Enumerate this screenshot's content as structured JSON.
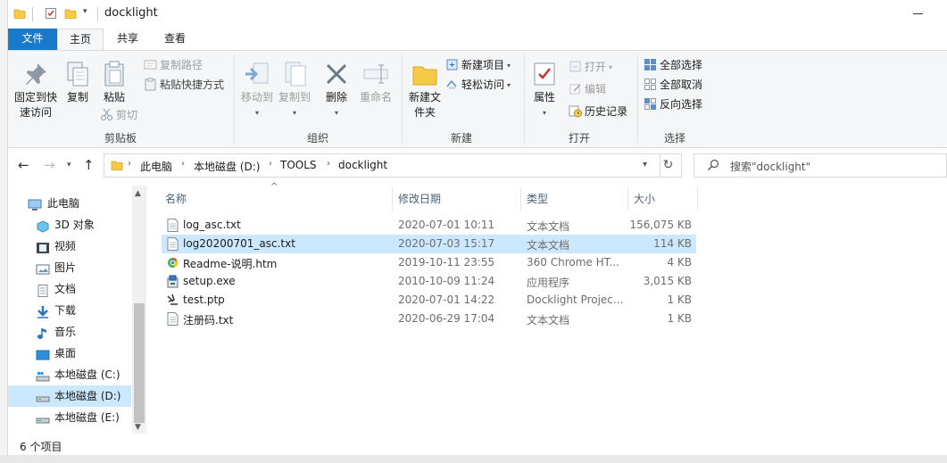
{
  "window": {
    "title": "docklight"
  },
  "tabs": {
    "file": "文件",
    "home": "主页",
    "share": "共享",
    "view": "查看"
  },
  "ribbon": {
    "clipboard": {
      "label": "剪贴板",
      "pin": "固定到快速访问",
      "copy": "复制",
      "paste": "粘贴",
      "copy_path": "复制路径",
      "paste_shortcut": "粘贴快捷方式",
      "cut": "剪切"
    },
    "organize": {
      "label": "组织",
      "move_to": "移动到",
      "copy_to": "复制到",
      "delete": "删除",
      "rename": "重命名"
    },
    "new": {
      "label": "新建",
      "new_folder": "新建文件夹",
      "new_item": "新建项目",
      "easy_access": "轻松访问"
    },
    "open": {
      "label": "打开",
      "properties": "属性",
      "open": "打开",
      "edit": "编辑",
      "history": "历史记录"
    },
    "select": {
      "label": "选择",
      "select_all": "全部选择",
      "select_none": "全部取消",
      "invert": "反向选择"
    }
  },
  "address": {
    "crumbs": [
      "此电脑",
      "本地磁盘 (D:)",
      "TOOLS",
      "docklight"
    ],
    "search_placeholder": "搜索\"docklight\""
  },
  "nav": {
    "items": [
      {
        "label": "此电脑",
        "icon": "computer-icon"
      },
      {
        "label": "3D 对象",
        "icon": "3d-objects-icon"
      },
      {
        "label": "视频",
        "icon": "video-icon"
      },
      {
        "label": "图片",
        "icon": "pictures-icon"
      },
      {
        "label": "文档",
        "icon": "documents-icon"
      },
      {
        "label": "下载",
        "icon": "download-icon"
      },
      {
        "label": "音乐",
        "icon": "music-icon"
      },
      {
        "label": "桌面",
        "icon": "desktop-icon"
      },
      {
        "label": "本地磁盘 (C:)",
        "icon": "drive-c-icon"
      },
      {
        "label": "本地磁盘 (D:)",
        "icon": "drive-d-icon",
        "selected": true
      },
      {
        "label": "本地磁盘 (E:)",
        "icon": "drive-e-icon"
      }
    ]
  },
  "columns": {
    "name": "名称",
    "date": "修改日期",
    "type": "类型",
    "size": "大小"
  },
  "files": [
    {
      "name": "log_asc.txt",
      "date": "2020-07-01 10:11",
      "type": "文本文档",
      "size": "156,075 KB",
      "icon": "text-file-icon"
    },
    {
      "name": "log20200701_asc.txt",
      "date": "2020-07-03 15:17",
      "type": "文本文档",
      "size": "114 KB",
      "icon": "text-file-icon",
      "selected": true
    },
    {
      "name": "Readme-说明.htm",
      "date": "2019-10-11 23:55",
      "type": "360 Chrome HT...",
      "size": "4 KB",
      "icon": "html-file-icon"
    },
    {
      "name": "setup.exe",
      "date": "2010-10-09 11:24",
      "type": "应用程序",
      "size": "3,015 KB",
      "icon": "installer-icon"
    },
    {
      "name": "test.ptp",
      "date": "2020-07-01 14:22",
      "type": "Docklight Projec...",
      "size": "1 KB",
      "icon": "project-file-icon"
    },
    {
      "name": "注册码.txt",
      "date": "2020-06-29 17:04",
      "type": "文本文档",
      "size": "1 KB",
      "icon": "text-file-icon"
    }
  ],
  "status": {
    "count": "6 个项目"
  },
  "colors": {
    "accent": "#1979ca",
    "selection": "#cce8ff",
    "folder": "#f7c948"
  }
}
